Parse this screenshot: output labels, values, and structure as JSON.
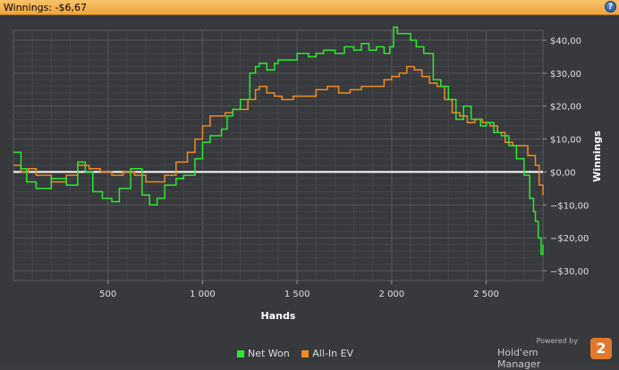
{
  "header": {
    "title": "Winnings: -$6,67",
    "help_glyph": "?"
  },
  "icons": {
    "help": "help-icon"
  },
  "colors": {
    "net_won": "#2ee82e",
    "all_in_ev": "#f08a24",
    "zero_line": "#ffffff",
    "header_bg": "#f2b04c"
  },
  "legend": [
    {
      "label": "Net Won",
      "color": "#2ee82e"
    },
    {
      "label": "All-In EV",
      "color": "#f08a24"
    }
  ],
  "brand": {
    "powered_by": "Powered by",
    "name": "Hold'em Manager",
    "logo_text": "2"
  },
  "chart_data": {
    "type": "line",
    "xlabel": "Hands",
    "ylabel": "Winnings",
    "xlim": [
      0,
      2800
    ],
    "ylim": [
      -33,
      43
    ],
    "x_ticks": [
      500,
      1000,
      1500,
      2000,
      2500
    ],
    "x_tick_labels": [
      "500",
      "1 000",
      "1 500",
      "2 000",
      "2 500"
    ],
    "y_ticks": [
      -30,
      -20,
      -10,
      0,
      10,
      20,
      30,
      40
    ],
    "y_tick_labels": [
      "−$30,00",
      "−$20,00",
      "−$10,00",
      "$0,00",
      "$10,00",
      "$20,00",
      "$30,00",
      "$40,00"
    ],
    "grid": true,
    "legend_position": "bottom-center",
    "series": [
      {
        "name": "Net Won",
        "x": [
          0,
          40,
          70,
          120,
          200,
          280,
          340,
          380,
          420,
          470,
          520,
          560,
          620,
          680,
          720,
          760,
          800,
          860,
          900,
          960,
          1000,
          1040,
          1080,
          1100,
          1130,
          1160,
          1200,
          1250,
          1280,
          1300,
          1340,
          1380,
          1400,
          1440,
          1500,
          1560,
          1600,
          1640,
          1700,
          1750,
          1800,
          1840,
          1880,
          1920,
          1960,
          1990,
          2010,
          2030,
          2060,
          2100,
          2130,
          2170,
          2220,
          2260,
          2300,
          2340,
          2380,
          2420,
          2470,
          2500,
          2540,
          2580,
          2620,
          2660,
          2700,
          2730,
          2750,
          2760,
          2775,
          2790,
          2800
        ],
        "y": [
          6,
          1,
          -3,
          -5,
          -2,
          -4,
          3,
          0,
          -6,
          -8,
          -9,
          -5,
          1,
          -7,
          -10,
          -8,
          -4,
          -2,
          -1,
          4,
          9,
          11,
          11,
          13,
          17,
          19,
          22,
          30,
          32,
          33,
          31,
          33,
          34,
          34,
          36,
          35,
          36,
          37,
          36,
          38,
          37,
          39,
          37,
          38,
          36,
          38,
          44,
          42,
          42,
          40,
          38,
          36,
          28,
          26,
          22,
          16,
          20,
          16,
          14,
          15,
          12,
          11,
          8,
          4,
          -1,
          -8,
          -12,
          -15,
          -20,
          -25,
          -22
        ]
      },
      {
        "name": "All-In EV",
        "x": [
          0,
          40,
          80,
          120,
          200,
          280,
          340,
          400,
          460,
          520,
          580,
          640,
          700,
          760,
          800,
          860,
          920,
          960,
          1000,
          1040,
          1080,
          1120,
          1160,
          1200,
          1240,
          1280,
          1300,
          1340,
          1380,
          1420,
          1480,
          1540,
          1600,
          1660,
          1720,
          1780,
          1840,
          1900,
          1960,
          2000,
          2040,
          2080,
          2120,
          2160,
          2200,
          2240,
          2280,
          2320,
          2360,
          2400,
          2440,
          2480,
          2520,
          2560,
          2600,
          2640,
          2680,
          2720,
          2760,
          2780,
          2800
        ],
        "y": [
          2,
          0,
          1,
          -1,
          -3,
          -1,
          2,
          1,
          0,
          -1,
          0,
          -1,
          -3,
          -3,
          -1,
          3,
          6,
          10,
          14,
          17,
          17,
          18,
          19,
          19,
          22,
          25,
          26,
          24,
          23,
          22,
          23,
          23,
          25,
          26,
          24,
          25,
          26,
          26,
          28,
          29,
          30,
          32,
          31,
          29,
          27,
          26,
          22,
          18,
          17,
          15,
          16,
          15,
          14,
          12,
          9,
          8,
          8,
          5,
          2,
          -4,
          -7
        ]
      }
    ]
  }
}
